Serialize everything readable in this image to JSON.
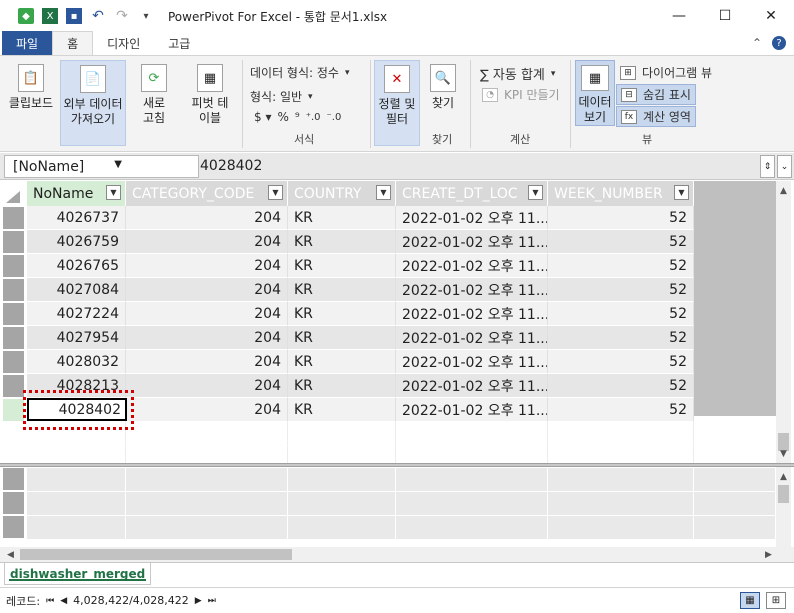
{
  "window": {
    "title": "PowerPivot For Excel - 통합 문서1.xlsx",
    "minimize": "—",
    "maximize": "☐",
    "close": "✕"
  },
  "ribbon_tabs": [
    {
      "label": "파일"
    },
    {
      "label": "홈"
    },
    {
      "label": "디자인"
    },
    {
      "label": "고급"
    }
  ],
  "ribbon": {
    "clipboard": "클립보드",
    "external": "외부 데이터 가져오기",
    "refresh": "새로 고침",
    "pivot": "피벗 테이블",
    "format_type": "데이터 형식: 정수",
    "format": "형식: 일반",
    "format_symbols": "$ · % ⁹ ⁰⁰",
    "format_group": "서식",
    "sort_filter": "정렬 및 필터",
    "find": "찾기",
    "find_group": "찾기",
    "autosum": "∑ 자동 합계",
    "kpi": "KPI 만들기",
    "calc_group": "계산",
    "data_view": "데이터 보기",
    "diagram_view": "다이어그램 뷰",
    "show_hidden": "숨김 표시",
    "calc_area": "계산 영역",
    "view_group": "뷰"
  },
  "formula_bar": {
    "name_box": "[NoName]",
    "value": "4028402"
  },
  "table": {
    "columns": [
      "NoName",
      "CATEGORY_CODE",
      "COUNTRY",
      "CREATE_DT_LOC",
      "WEEK_NUMBER"
    ],
    "rows": [
      [
        "4026737",
        "204",
        "KR",
        "2022-01-02 오후 11...",
        "52"
      ],
      [
        "4026759",
        "204",
        "KR",
        "2022-01-02 오후 11...",
        "52"
      ],
      [
        "4026765",
        "204",
        "KR",
        "2022-01-02 오후 11...",
        "52"
      ],
      [
        "4027084",
        "204",
        "KR",
        "2022-01-02 오후 11...",
        "52"
      ],
      [
        "4027224",
        "204",
        "KR",
        "2022-01-02 오후 11...",
        "52"
      ],
      [
        "4027954",
        "204",
        "KR",
        "2022-01-02 오후 11...",
        "52"
      ],
      [
        "4028032",
        "204",
        "KR",
        "2022-01-02 오후 11...",
        "52"
      ],
      [
        "4028213",
        "204",
        "KR",
        "2022-01-02 오후 11...",
        "52"
      ],
      [
        "4028402",
        "204",
        "KR",
        "2022-01-02 오후 11...",
        "52"
      ]
    ]
  },
  "sheet_tab": "dishwasher_merged",
  "status": {
    "record_label": "레코드:",
    "record_value": "4,028,422/4,028,422"
  },
  "colors": {
    "file_tab": "#2b579a",
    "sheet_tab": "#217346",
    "annotation": "#d40000"
  }
}
